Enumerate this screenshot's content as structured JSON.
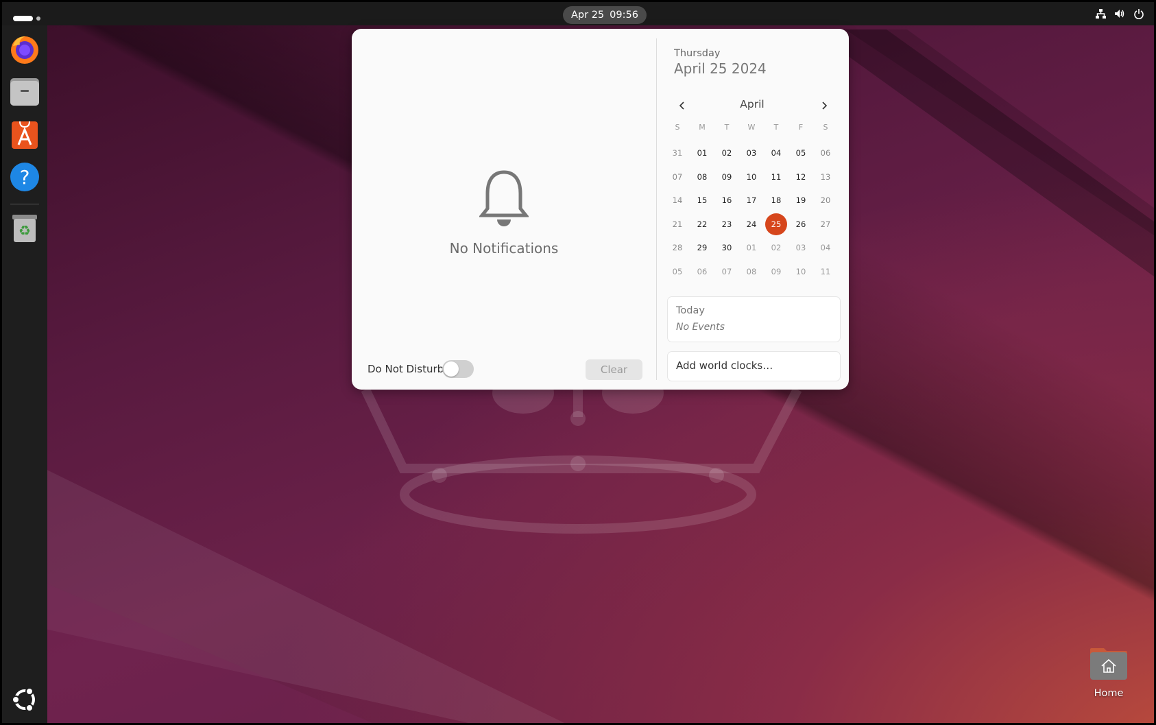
{
  "topbar": {
    "clock_date": "Apr 25",
    "clock_time": "09:56",
    "tray_icons": [
      "network-icon",
      "volume-icon",
      "power-icon"
    ]
  },
  "dock": {
    "apps": [
      "Firefox",
      "Files",
      "App Center",
      "Help",
      "Trash"
    ],
    "show_apps_icon": "ubuntu-logo-icon"
  },
  "notifications": {
    "empty_text": "No Notifications",
    "dnd_label": "Do Not Disturb",
    "dnd_enabled": false,
    "clear_label": "Clear"
  },
  "calendar": {
    "weekday": "Thursday",
    "full_date": "April 25 2024",
    "month": "April",
    "day_headers": [
      "S",
      "M",
      "T",
      "W",
      "T",
      "F",
      "S"
    ],
    "weeks": [
      [
        "31",
        "01",
        "02",
        "03",
        "04",
        "05",
        "06"
      ],
      [
        "07",
        "08",
        "09",
        "10",
        "11",
        "12",
        "13"
      ],
      [
        "14",
        "15",
        "16",
        "17",
        "18",
        "19",
        "20"
      ],
      [
        "21",
        "22",
        "23",
        "24",
        "25",
        "26",
        "27"
      ],
      [
        "28",
        "29",
        "30",
        "01",
        "02",
        "03",
        "04"
      ],
      [
        "05",
        "06",
        "07",
        "08",
        "09",
        "10",
        "11"
      ]
    ],
    "today": "25",
    "today_color": "#d6461c"
  },
  "events": {
    "title": "Today",
    "empty_text": "No Events"
  },
  "world_clocks": {
    "label": "Add world clocks…"
  },
  "desktop": {
    "home_label": "Home"
  }
}
